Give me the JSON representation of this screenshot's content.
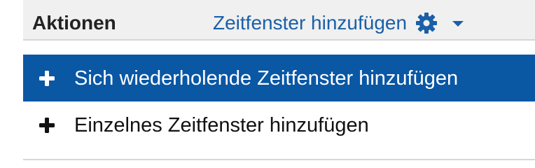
{
  "header": {
    "title": "Aktionen",
    "action_label": "Zeitfenster hinzufügen",
    "action_icon": "gear-icon",
    "dropdown_icon": "caret-down-icon",
    "accent_color": "#1a5fa8"
  },
  "menu": {
    "items": [
      {
        "label": "Sich wiederholende Zeitfenster hinzufügen",
        "icon": "plus-icon",
        "state": "highlighted",
        "highlight_color": "#0a57a4"
      },
      {
        "label": "Einzelnes Zeitfenster hinzufügen",
        "icon": "plus-icon",
        "state": "normal"
      }
    ]
  }
}
